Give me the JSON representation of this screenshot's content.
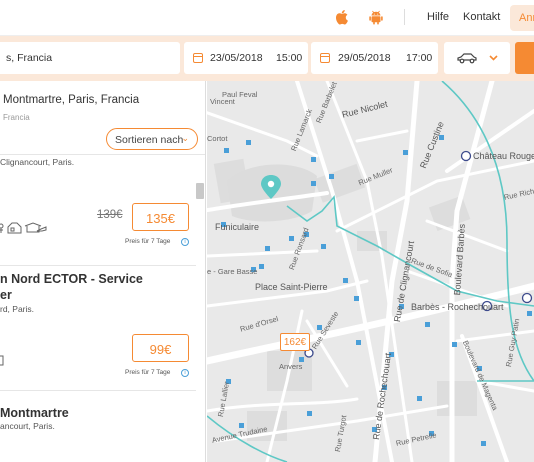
{
  "topbar": {
    "hilfe": "Hilfe",
    "kontakt": "Kontakt",
    "login": "Anmelden"
  },
  "search": {
    "location": "s, Francia",
    "start_date": "23/05/2018",
    "start_time": "15:00",
    "end_date": "29/05/2018",
    "end_time": "17:00"
  },
  "list": {
    "title": "Montmartre, Paris, Francia",
    "subtitle": "Francia",
    "sort_label": "Sortieren nach",
    "cards": [
      {
        "name": "",
        "address": "Clignancourt, Paris.",
        "old_price": "139€",
        "price": "135€",
        "price_note": "Preis für 7 Tage"
      },
      {
        "name": "n Nord ECTOR - Service",
        "name2": "er",
        "address": "rd, Paris.",
        "old_price": "",
        "price": "99€",
        "price_note": "Preis für 7 Tage"
      },
      {
        "name": "Montmartre",
        "address": "ancourt, Paris."
      }
    ]
  },
  "map": {
    "labels": {
      "paul_feval": "Paul Feval",
      "vincent": "Vincent",
      "barbelet": "Rue Barbelet",
      "lamarck": "Rue Lamarck",
      "nicolet": "Rue Nicolet",
      "custine": "Rue Custine",
      "chateau_rouge": "Château Rouge",
      "cortot": "Cortot",
      "rue_muller": "Rue Muller",
      "richomme": "Rue Richom",
      "funiculaire": "Funiculaire",
      "clignancourt": "Rue de Clignancourt",
      "barbes": "Boulevard Barbès",
      "gare_basse": "e - Gare Basse",
      "rue_de_sofia": "Rue de Sofia",
      "ronsard": "Rue Ronsard",
      "place_saint_pierre": "Place Saint-Pierre",
      "barbes_rochechouart": "Barbès - Rochechouart",
      "rue_dorsel": "Rue d'Orsel",
      "rue_seveste": "Rue Seveste",
      "guy_patin": "Rue Guy Patin",
      "magenta": "Boulevard de Magenta",
      "rochechouart": "Rue de Rochechouart",
      "lallier": "Rue Lallier",
      "trudaine": "Avenue Trudaine",
      "rue_petrelle": "Rue Petrelle",
      "anvers": "Anvers",
      "rue_turgot": "Rue Turgot"
    },
    "price_bubble": "162€"
  },
  "colors": {
    "accent": "#f58a33",
    "route": "#5ec8c5",
    "metro": "#4a9fd8"
  }
}
